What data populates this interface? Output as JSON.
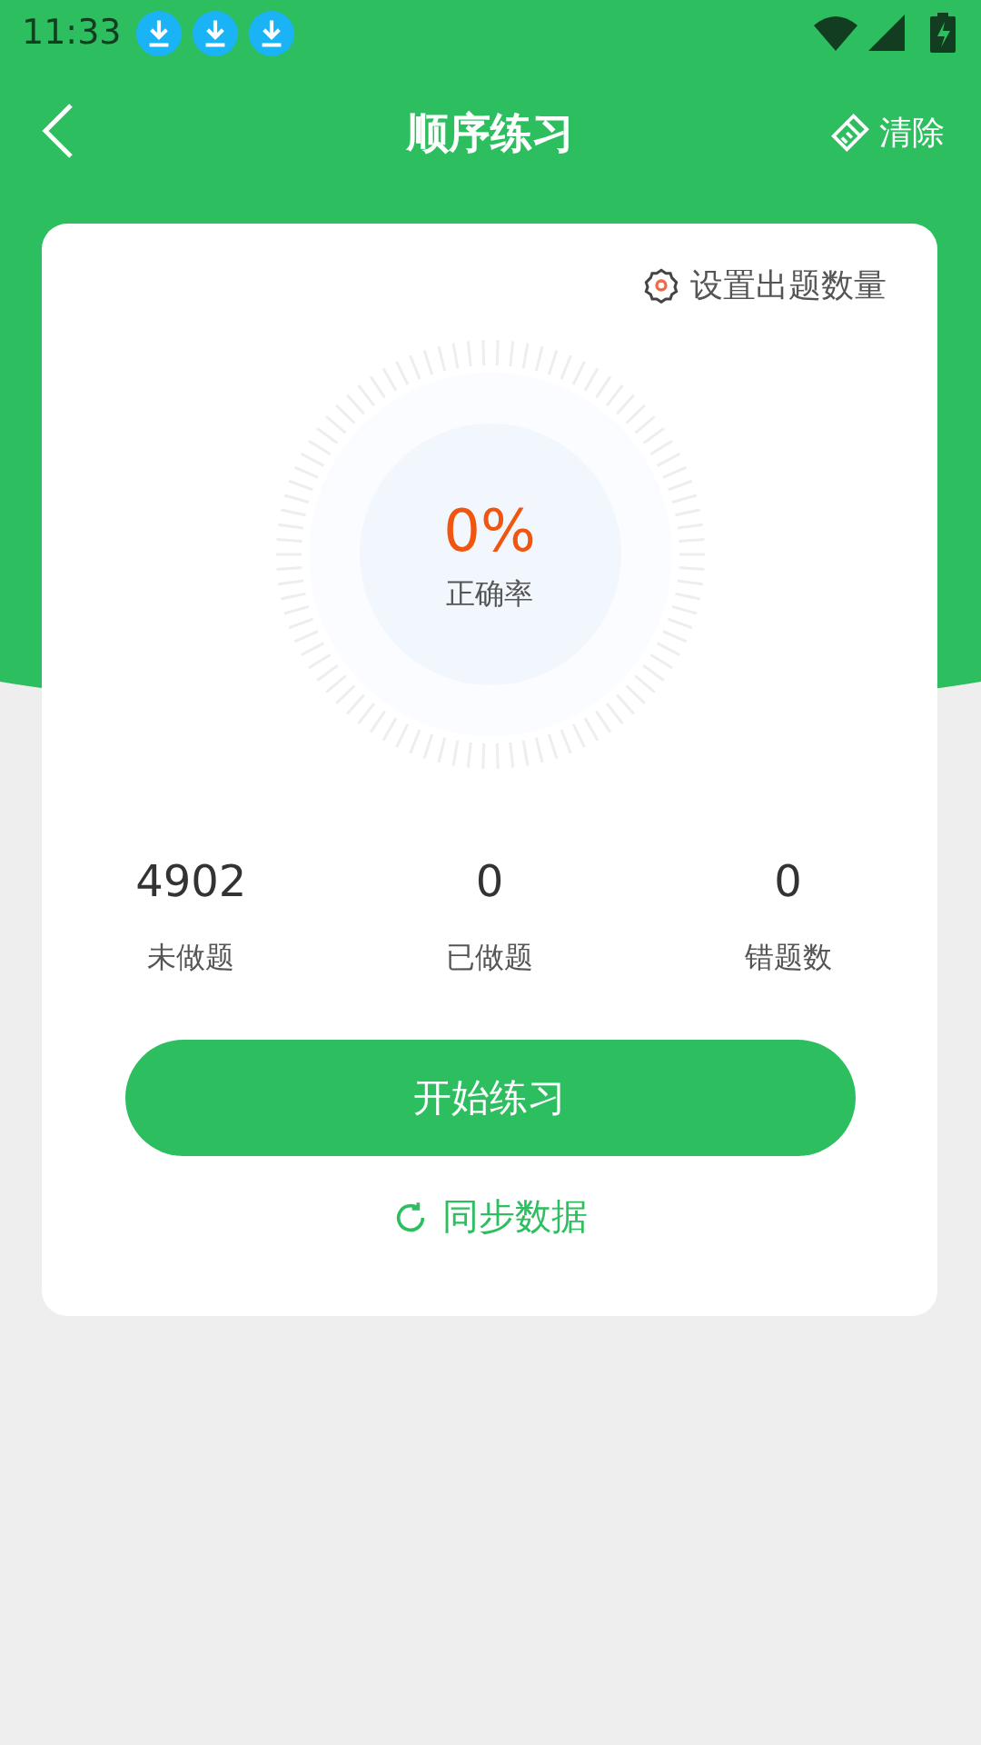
{
  "status_bar": {
    "time": "11:33",
    "notifications": [
      {
        "kind": "download"
      },
      {
        "kind": "download"
      },
      {
        "kind": "download"
      }
    ]
  },
  "nav": {
    "title": "顺序练习",
    "action": "清除"
  },
  "card": {
    "settings": "设置出题数量",
    "accuracy": {
      "value": "0%",
      "label": "正确率"
    },
    "stats": [
      {
        "value": "4902",
        "label": "未做题"
      },
      {
        "value": "0",
        "label": "已做题"
      },
      {
        "value": "0",
        "label": "错题数"
      }
    ],
    "start_button": "开始练习",
    "sync": "同步数据"
  }
}
